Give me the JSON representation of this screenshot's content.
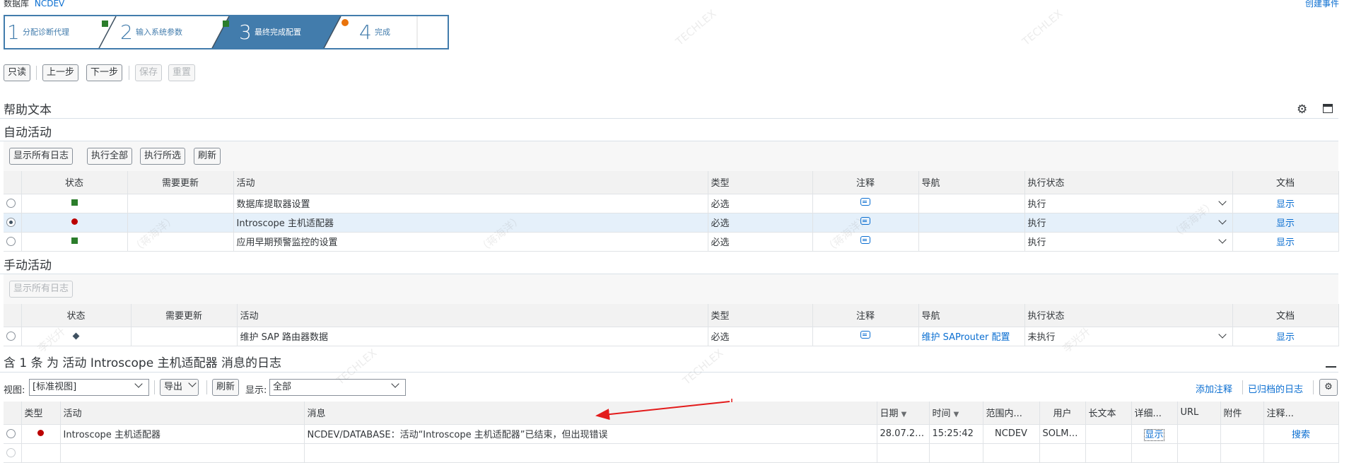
{
  "header": {
    "db_label": "数据库",
    "db_value": "NCDEV",
    "create_event": "创建事件"
  },
  "steps": [
    {
      "num": "1",
      "label": "分配诊断代理",
      "status_color": "#2b7d2b",
      "active": false
    },
    {
      "num": "2",
      "label": "输入系统参数",
      "status_color": "#2b7d2b",
      "active": false
    },
    {
      "num": "3",
      "label": "最终完成配置",
      "status_color": "#e9730c",
      "active": true
    },
    {
      "num": "4",
      "label": "完成",
      "status_color": "",
      "active": false
    }
  ],
  "toolbar": {
    "readonly": "只读",
    "prev": "上一步",
    "next": "下一步",
    "save": "保存",
    "reset": "重置"
  },
  "help_title": "帮助文本",
  "auto": {
    "title": "自动活动",
    "buttons": {
      "show_all_logs": "显示所有日志",
      "exec_all": "执行全部",
      "exec_selected": "执行所选",
      "refresh": "刷新"
    },
    "columns": [
      "状态",
      "需要更新",
      "活动",
      "类型",
      "注释",
      "导航",
      "执行状态",
      "文档"
    ],
    "rows": [
      {
        "status": "green",
        "activity": "数据库提取器设置",
        "type": "必选",
        "nav": "",
        "exec": "执行",
        "doc": "显示",
        "selected": false
      },
      {
        "status": "red",
        "activity": "Introscope 主机适配器",
        "type": "必选",
        "nav": "",
        "exec": "执行",
        "doc": "显示",
        "selected": true
      },
      {
        "status": "green",
        "activity": "应用早期预警监控的设置",
        "type": "必选",
        "nav": "",
        "exec": "执行",
        "doc": "显示",
        "selected": false
      }
    ]
  },
  "manual": {
    "title": "手动活动",
    "buttons": {
      "show_all_logs": "显示所有日志"
    },
    "columns": [
      "状态",
      "需要更新",
      "活动",
      "类型",
      "注释",
      "导航",
      "执行状态",
      "文档"
    ],
    "rows": [
      {
        "status": "diamond",
        "activity": "维护 SAP 路由器数据",
        "type": "必选",
        "nav": "维护 SAProuter 配置",
        "exec": "未执行",
        "doc": "显示"
      }
    ]
  },
  "log": {
    "title": "含 1 条 为 活动 Introscope 主机适配器 消息的日志",
    "view_label": "视图:",
    "view_value": "[标准视图]",
    "export": "导出",
    "refresh": "刷新",
    "display_label": "显示:",
    "display_value": "全部",
    "add_note": "添加注释",
    "archived_logs": "已归档的日志",
    "columns": [
      "类型",
      "活动",
      "消息",
      "日期",
      "时间",
      "范围内...",
      "用户",
      "长文本",
      "详细...",
      "URL",
      "附件",
      "注释..."
    ],
    "rows": [
      {
        "type": "red",
        "activity": "Introscope 主机适配器",
        "message": "NCDEV/DATABASE：活动“Introscope 主机适配器”已结束，但出现错误",
        "date": "28.07.20...",
        "time": "15:25:42",
        "scope": "NCDEV",
        "user": "SOLMA...",
        "longtext": "",
        "detail": "显示",
        "url": "",
        "attach": "",
        "note": "搜索"
      }
    ]
  },
  "watermarks": [
    "TECHLEX",
    "（蒋海洋）",
    "李光升"
  ],
  "colors": {
    "accent": "#0a6ed1",
    "step_active": "#427cac",
    "ok": "#2b7d2b",
    "error": "#bb0000",
    "arrow": "#e31b1b"
  }
}
